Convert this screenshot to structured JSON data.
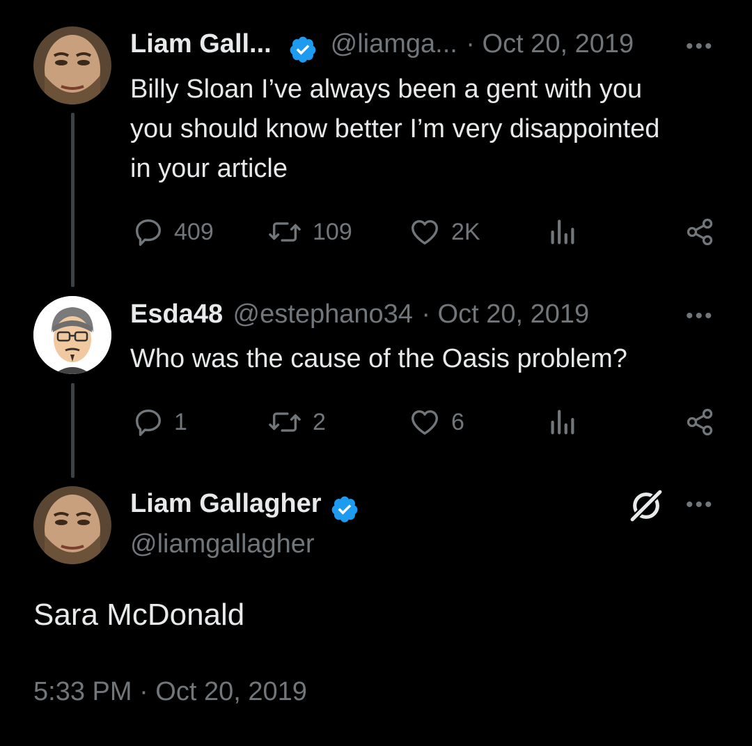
{
  "tweet1": {
    "name": "Liam Gall...",
    "handle": "@liamga...",
    "date": "· Oct 20, 2019",
    "lines": [
      "Billy Sloan  I’ve always been a gent with you",
      "you should know better I’m very disappointed",
      "in your article"
    ],
    "replies": "409",
    "retweets": "109",
    "likes": "2K"
  },
  "tweet2": {
    "name": "Esda48",
    "handle": "@estephano34",
    "date": "· Oct 20, 2019",
    "text": "Who was the cause of the Oasis problem?",
    "replies": "1",
    "retweets": "2",
    "likes": "6"
  },
  "tweet3": {
    "name": "Liam Gallagher",
    "handle": "@liamgallagher",
    "text": "Sara McDonald",
    "timestamp": "5:33 PM · Oct 20, 2019"
  },
  "icons": {
    "more": "•••",
    "verified_color": "#1d9bf0"
  }
}
